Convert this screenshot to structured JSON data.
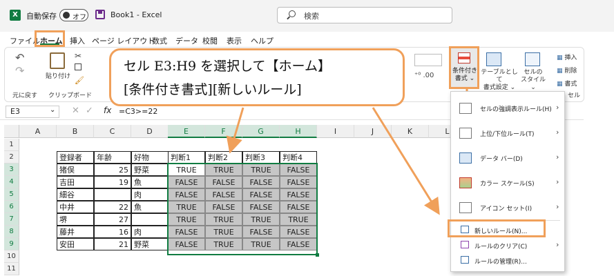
{
  "title_bar": {
    "autosave_label": "自動保存",
    "autosave_state": "オフ",
    "document_title": "Book1  -  Excel",
    "search_placeholder": "検索"
  },
  "menu_tabs": [
    "ファイル",
    "ホーム",
    "挿入",
    "ページ レイアウト",
    "数式",
    "データ",
    "校閲",
    "表示",
    "ヘルプ"
  ],
  "ribbon": {
    "undo_label": "元に戻す",
    "paste_label": "貼り付け",
    "clipboard_label": "クリップボード",
    "cf_label_line1": "条件付き",
    "cf_label_line2": "書式 ⌄",
    "table_label_line1": "テーブルとして",
    "table_label_line2": "書式設定 ⌄",
    "cellstyle_label_line1": "セルの",
    "cellstyle_label_line2": "スタイル ⌄",
    "insert_label": "挿入",
    "delete_label": "削除",
    "format_label": "書式",
    "cell_group": "セル"
  },
  "formula_bar": {
    "name_box": "E3",
    "fx": "fx",
    "formula": "=C3>=22"
  },
  "columns": [
    "A",
    "B",
    "C",
    "D",
    "E",
    "F",
    "G",
    "H",
    "I",
    "J",
    "K",
    "L"
  ],
  "rows": [
    "1",
    "2",
    "3",
    "4",
    "5",
    "6",
    "7",
    "8",
    "9",
    "10",
    "11"
  ],
  "table": {
    "headers": [
      "登録者",
      "年齢",
      "好物",
      "判断1",
      "判断2",
      "判断3",
      "判断4"
    ],
    "data": [
      [
        "猪俣",
        "25",
        "野菜",
        "TRUE",
        "TRUE",
        "TRUE",
        "FALSE"
      ],
      [
        "吉田",
        "19",
        "魚",
        "FALSE",
        "FALSE",
        "FALSE",
        "FALSE"
      ],
      [
        "細谷",
        "",
        "肉",
        "FALSE",
        "FALSE",
        "FALSE",
        "FALSE"
      ],
      [
        "中井",
        "22",
        "魚",
        "TRUE",
        "FALSE",
        "FALSE",
        "FALSE"
      ],
      [
        "堺",
        "27",
        "",
        "TRUE",
        "TRUE",
        "TRUE",
        "TRUE"
      ],
      [
        "藤井",
        "16",
        "肉",
        "FALSE",
        "TRUE",
        "FALSE",
        "FALSE"
      ],
      [
        "安田",
        "21",
        "野菜",
        "FALSE",
        "TRUE",
        "TRUE",
        "FALSE"
      ]
    ]
  },
  "callout": {
    "line1": "セル E3:H9 を選択して【ホーム】",
    "line2": "[条件付き書式][新しいルール]"
  },
  "cf_menu": {
    "items": [
      {
        "label": "セルの強調表示ルール(H)",
        "icon": "highlight-rules-icon"
      },
      {
        "label": "上位/下位ルール(T)",
        "icon": "top-bottom-icon"
      },
      {
        "label": "データ バー(D)",
        "icon": "data-bars-icon"
      },
      {
        "label": "カラー スケール(S)",
        "icon": "color-scale-icon"
      },
      {
        "label": "アイコン セット(I)",
        "icon": "icon-sets-icon"
      }
    ],
    "new_rule": "新しいルール(N)...",
    "clear_rules": "ルールのクリア(C)",
    "manage_rules": "ルールの管理(R)..."
  },
  "colors": {
    "excel_green": "#107c41",
    "highlight_orange": "#f0a05a",
    "selection_gray": "#c6c6c6"
  }
}
